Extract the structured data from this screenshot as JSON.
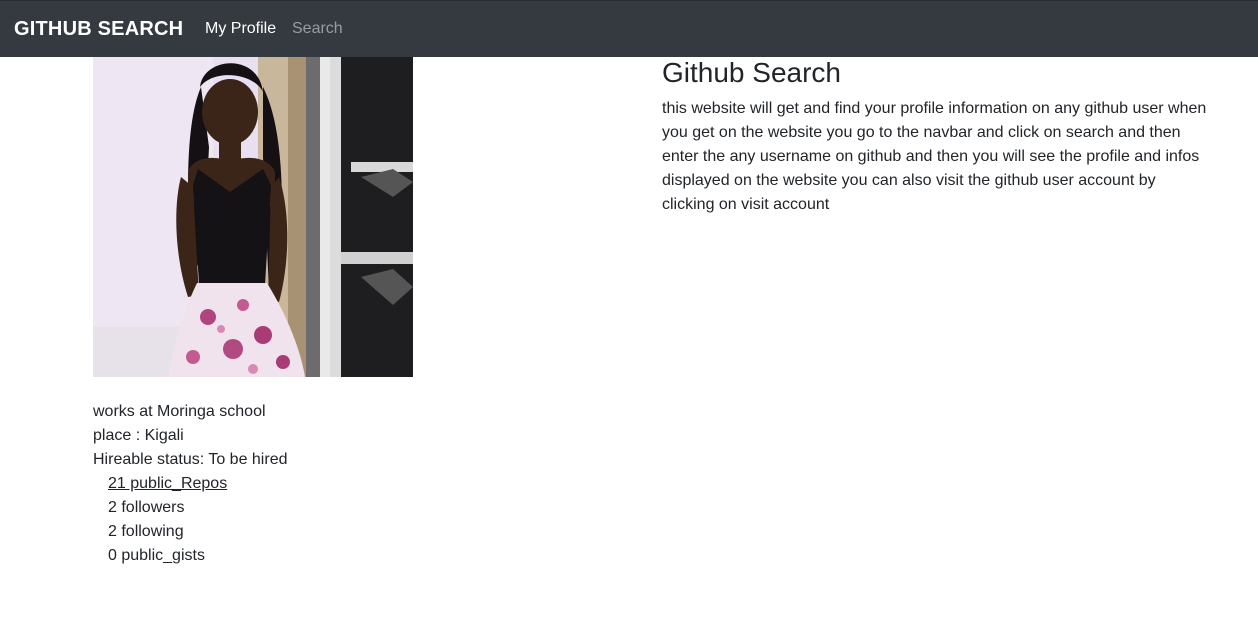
{
  "navbar": {
    "brand": "GITHUB SEARCH",
    "links": [
      {
        "label": "My Profile"
      },
      {
        "label": "Search"
      }
    ]
  },
  "profile": {
    "works": "works at Moringa school",
    "place": "place : Kigali",
    "hireable": "Hireable status: To be hired",
    "stats": {
      "repos": "21 public_Repos",
      "followers": "2 followers",
      "following": "2 following",
      "gists": "0 public_gists"
    }
  },
  "about": {
    "title": "Github Search",
    "description": "this website will get and find your profile information on any github user when you get on the website you go to the navbar and click on search and then enter the any username on github and then you will see the profile and infos displayed on the website you can also visit the github user account by clicking on visit account"
  }
}
